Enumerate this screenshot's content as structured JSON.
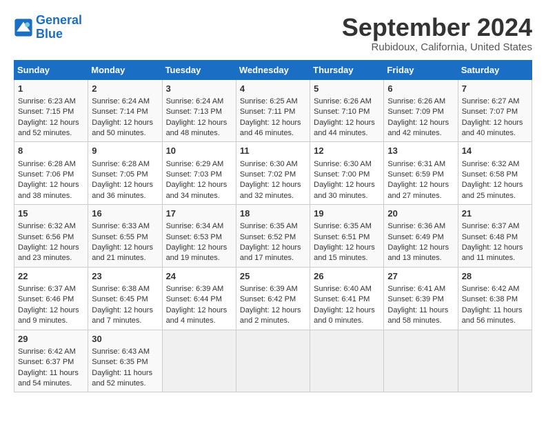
{
  "logo": {
    "line1": "General",
    "line2": "Blue"
  },
  "title": "September 2024",
  "subtitle": "Rubidoux, California, United States",
  "days_of_week": [
    "Sunday",
    "Monday",
    "Tuesday",
    "Wednesday",
    "Thursday",
    "Friday",
    "Saturday"
  ],
  "weeks": [
    [
      {
        "day": "1",
        "sunrise": "6:23 AM",
        "sunset": "7:15 PM",
        "daylight": "12 hours and 52 minutes."
      },
      {
        "day": "2",
        "sunrise": "6:24 AM",
        "sunset": "7:14 PM",
        "daylight": "12 hours and 50 minutes."
      },
      {
        "day": "3",
        "sunrise": "6:24 AM",
        "sunset": "7:13 PM",
        "daylight": "12 hours and 48 minutes."
      },
      {
        "day": "4",
        "sunrise": "6:25 AM",
        "sunset": "7:11 PM",
        "daylight": "12 hours and 46 minutes."
      },
      {
        "day": "5",
        "sunrise": "6:26 AM",
        "sunset": "7:10 PM",
        "daylight": "12 hours and 44 minutes."
      },
      {
        "day": "6",
        "sunrise": "6:26 AM",
        "sunset": "7:09 PM",
        "daylight": "12 hours and 42 minutes."
      },
      {
        "day": "7",
        "sunrise": "6:27 AM",
        "sunset": "7:07 PM",
        "daylight": "12 hours and 40 minutes."
      }
    ],
    [
      {
        "day": "8",
        "sunrise": "6:28 AM",
        "sunset": "7:06 PM",
        "daylight": "12 hours and 38 minutes."
      },
      {
        "day": "9",
        "sunrise": "6:28 AM",
        "sunset": "7:05 PM",
        "daylight": "12 hours and 36 minutes."
      },
      {
        "day": "10",
        "sunrise": "6:29 AM",
        "sunset": "7:03 PM",
        "daylight": "12 hours and 34 minutes."
      },
      {
        "day": "11",
        "sunrise": "6:30 AM",
        "sunset": "7:02 PM",
        "daylight": "12 hours and 32 minutes."
      },
      {
        "day": "12",
        "sunrise": "6:30 AM",
        "sunset": "7:00 PM",
        "daylight": "12 hours and 30 minutes."
      },
      {
        "day": "13",
        "sunrise": "6:31 AM",
        "sunset": "6:59 PM",
        "daylight": "12 hours and 27 minutes."
      },
      {
        "day": "14",
        "sunrise": "6:32 AM",
        "sunset": "6:58 PM",
        "daylight": "12 hours and 25 minutes."
      }
    ],
    [
      {
        "day": "15",
        "sunrise": "6:32 AM",
        "sunset": "6:56 PM",
        "daylight": "12 hours and 23 minutes."
      },
      {
        "day": "16",
        "sunrise": "6:33 AM",
        "sunset": "6:55 PM",
        "daylight": "12 hours and 21 minutes."
      },
      {
        "day": "17",
        "sunrise": "6:34 AM",
        "sunset": "6:53 PM",
        "daylight": "12 hours and 19 minutes."
      },
      {
        "day": "18",
        "sunrise": "6:35 AM",
        "sunset": "6:52 PM",
        "daylight": "12 hours and 17 minutes."
      },
      {
        "day": "19",
        "sunrise": "6:35 AM",
        "sunset": "6:51 PM",
        "daylight": "12 hours and 15 minutes."
      },
      {
        "day": "20",
        "sunrise": "6:36 AM",
        "sunset": "6:49 PM",
        "daylight": "12 hours and 13 minutes."
      },
      {
        "day": "21",
        "sunrise": "6:37 AM",
        "sunset": "6:48 PM",
        "daylight": "12 hours and 11 minutes."
      }
    ],
    [
      {
        "day": "22",
        "sunrise": "6:37 AM",
        "sunset": "6:46 PM",
        "daylight": "12 hours and 9 minutes."
      },
      {
        "day": "23",
        "sunrise": "6:38 AM",
        "sunset": "6:45 PM",
        "daylight": "12 hours and 7 minutes."
      },
      {
        "day": "24",
        "sunrise": "6:39 AM",
        "sunset": "6:44 PM",
        "daylight": "12 hours and 4 minutes."
      },
      {
        "day": "25",
        "sunrise": "6:39 AM",
        "sunset": "6:42 PM",
        "daylight": "12 hours and 2 minutes."
      },
      {
        "day": "26",
        "sunrise": "6:40 AM",
        "sunset": "6:41 PM",
        "daylight": "12 hours and 0 minutes."
      },
      {
        "day": "27",
        "sunrise": "6:41 AM",
        "sunset": "6:39 PM",
        "daylight": "11 hours and 58 minutes."
      },
      {
        "day": "28",
        "sunrise": "6:42 AM",
        "sunset": "6:38 PM",
        "daylight": "11 hours and 56 minutes."
      }
    ],
    [
      {
        "day": "29",
        "sunrise": "6:42 AM",
        "sunset": "6:37 PM",
        "daylight": "11 hours and 54 minutes."
      },
      {
        "day": "30",
        "sunrise": "6:43 AM",
        "sunset": "6:35 PM",
        "daylight": "11 hours and 52 minutes."
      },
      null,
      null,
      null,
      null,
      null
    ]
  ]
}
